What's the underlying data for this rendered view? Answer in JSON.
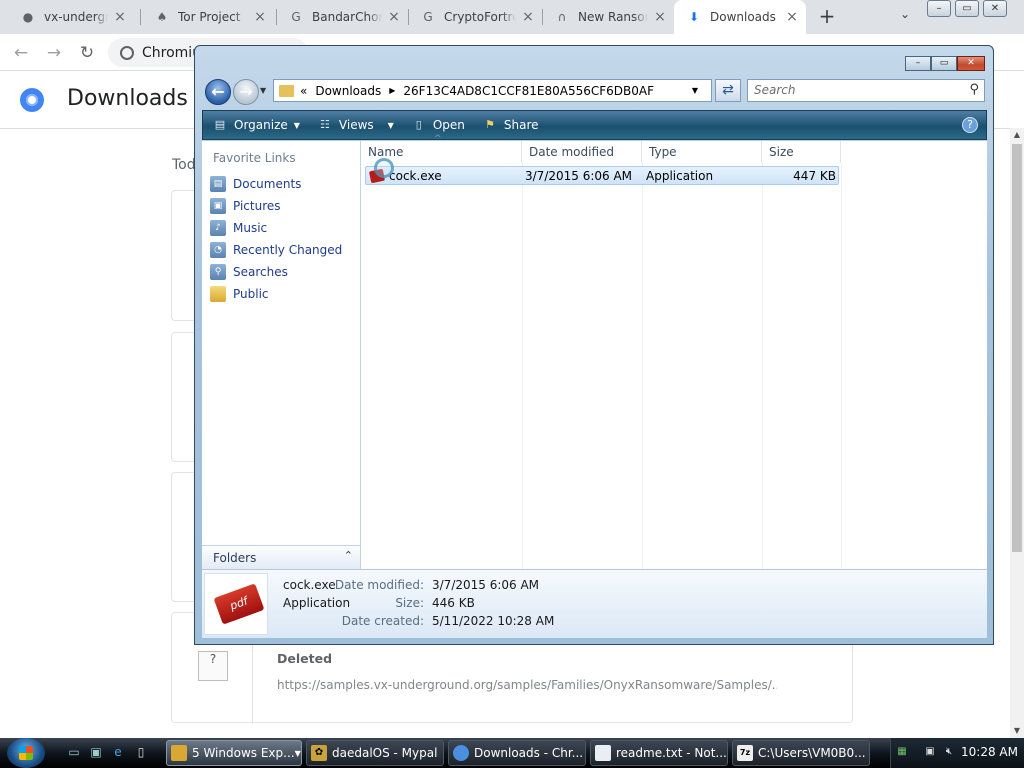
{
  "browser": {
    "tabs": [
      {
        "label": "vx-undergro",
        "icon": "github-icon",
        "glyph": "●"
      },
      {
        "label": "Tor Project",
        "icon": "onion-icon",
        "glyph": "♠"
      },
      {
        "label": "BandarChorR",
        "icon": "google-icon",
        "glyph": "G"
      },
      {
        "label": "CryptoFortre",
        "icon": "google-icon",
        "glyph": "G"
      },
      {
        "label": "New Ransom",
        "icon": "headset-icon",
        "glyph": "∩"
      },
      {
        "label": "Downloads",
        "icon": "download-icon",
        "glyph": "⬇"
      }
    ],
    "omnibox_text": "Chromiu",
    "page_title": "Downloads",
    "date_group": "Toda",
    "last_item": {
      "status": "Deleted",
      "url": "https://samples.vx-underground.org/samples/Families/OnyxRansomware/Samples/..."
    }
  },
  "explorer": {
    "breadcrumb": [
      "Downloads",
      "26F13C4AD8C1CCF81E80A556CF6DB0AF"
    ],
    "search_placeholder": "Search",
    "commands": [
      {
        "label": "Organize",
        "icon": "organize-icon",
        "dropdown": true
      },
      {
        "label": "Views",
        "icon": "views-icon",
        "dropdown": true
      },
      {
        "label": "Open",
        "icon": "open-icon",
        "dropdown": false
      },
      {
        "label": "Share",
        "icon": "share-icon",
        "dropdown": false
      }
    ],
    "favorite_links_header": "Favorite Links",
    "favorite_links": [
      {
        "label": "Documents",
        "icon": "documents-icon"
      },
      {
        "label": "Pictures",
        "icon": "pictures-icon"
      },
      {
        "label": "Music",
        "icon": "music-icon"
      },
      {
        "label": "Recently Changed",
        "icon": "recently-changed-icon"
      },
      {
        "label": "Searches",
        "icon": "searches-icon"
      },
      {
        "label": "Public",
        "icon": "public-folder-icon"
      }
    ],
    "folders_label": "Folders",
    "columns": [
      "Name",
      "Date modified",
      "Type",
      "Size"
    ],
    "files": [
      {
        "name": "cock.exe",
        "date_modified": "3/7/2015 6:06 AM",
        "type": "Application",
        "size": "447 KB"
      }
    ],
    "details": {
      "name": "cock.exe",
      "type": "Application",
      "date_modified_label": "Date modified:",
      "date_modified": "3/7/2015 6:06 AM",
      "size_label": "Size:",
      "size": "446 KB",
      "date_created_label": "Date created:",
      "date_created": "5/11/2022 10:28 AM",
      "thumb_text": "pdf"
    }
  },
  "taskbar": {
    "buttons": [
      {
        "label": "5 Windows Exp...",
        "icon": "folder-icon",
        "active": true,
        "group": true
      },
      {
        "label": "daedalOS - Mypal",
        "icon": "mypal-icon",
        "active": false,
        "group": false
      },
      {
        "label": "Downloads - Chr...",
        "icon": "chromium-icon",
        "active": false,
        "group": false
      },
      {
        "label": "readme.txt - Not...",
        "icon": "notepad-icon",
        "active": false,
        "group": false
      },
      {
        "label": "C:\\Users\\VM0B0...",
        "icon": "7zip-icon",
        "active": false,
        "group": false
      }
    ],
    "clock": "10:28 AM"
  }
}
